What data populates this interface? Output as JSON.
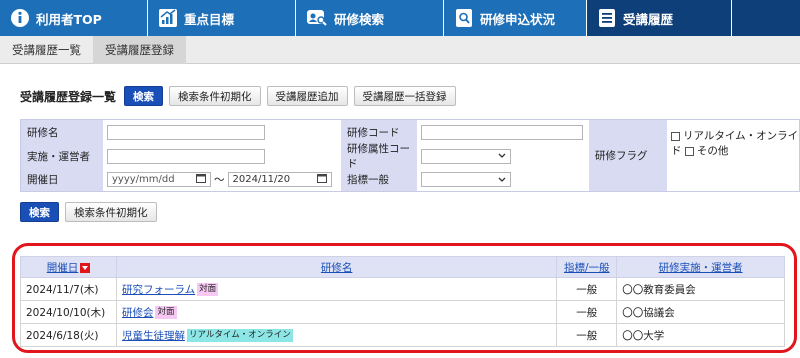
{
  "nav": [
    {
      "label": "利用者TOP",
      "icon": "info-icon",
      "active": false
    },
    {
      "label": "重点目標",
      "icon": "growth-chart-icon",
      "active": false
    },
    {
      "label": "研修検索",
      "icon": "person-search-icon",
      "active": false
    },
    {
      "label": "研修申込状況",
      "icon": "application-status-icon",
      "active": false
    },
    {
      "label": "受講履歴",
      "icon": "list-icon",
      "active": true
    }
  ],
  "subtabs": [
    {
      "label": "受講履歴一覧",
      "active": false
    },
    {
      "label": "受講履歴登録",
      "active": true
    }
  ],
  "section": {
    "title": "受講履歴登録一覧",
    "search": "検索",
    "reset": "検索条件初期化",
    "add": "受講履歴追加",
    "bulk": "受講履歴一括登録"
  },
  "form": {
    "name_label": "研修名",
    "org_label": "実施・運営者",
    "date_label": "開催日",
    "date_from_placeholder": "yyyy/mm/dd",
    "tilde": "～",
    "date_to": "2024/11/20",
    "code_label": "研修コード",
    "attr_label": "研修属性コード",
    "index_label": "指標一般",
    "flag_label": "研修フラグ",
    "flag_opt1": "リアルタイム・オンライン",
    "flag_opt1_cont": "ド",
    "flag_opt2": "その他"
  },
  "buttons2": {
    "search": "検索",
    "reset": "検索条件初期化"
  },
  "table": {
    "headers": [
      "開催日",
      "研修名",
      "指標/一般",
      "研修実施・運営者"
    ],
    "rows": [
      {
        "date": "2024/11/7(木)",
        "name": "研究フォーラム",
        "tag": "対面",
        "tag_color": "#f7c8f3",
        "kind": "一般",
        "org": "〇〇教育委員会"
      },
      {
        "date": "2024/10/10(木)",
        "name": "研修会",
        "tag": "対面",
        "tag_color": "#f7c8f3",
        "kind": "一般",
        "org": "〇〇協議会"
      },
      {
        "date": "2024/6/18(火)",
        "name": "児童生徒理解",
        "tag": "リアルタイム・オンライン",
        "tag_color": "#8de6e6",
        "kind": "一般",
        "org": "〇〇大学"
      }
    ]
  },
  "colors": {
    "nav": "#1d6fb8",
    "nav_active": "#0f3f78",
    "primary": "#1a4fb8",
    "highlight": "#e1161d",
    "form_label": "#d9dbf2"
  }
}
